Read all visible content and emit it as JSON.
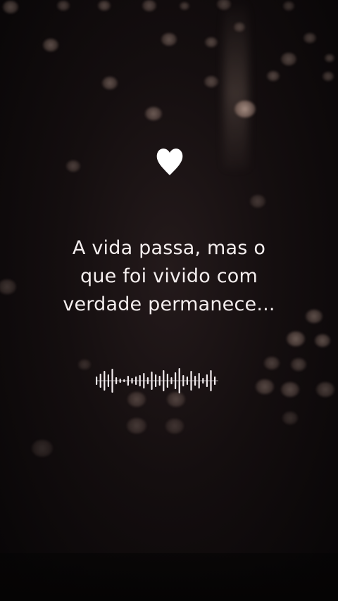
{
  "quote": {
    "lines": [
      "A vida passa, mas o",
      "que foi vivido com",
      "verdade permanece..."
    ]
  },
  "icons": {
    "heart": "heart-icon",
    "audio": "audio-waveform-icon"
  },
  "colors": {
    "text": "#f4eeee",
    "heart": "#ffffff",
    "background": "#140e0f",
    "bokeh": "#c9a89a"
  }
}
